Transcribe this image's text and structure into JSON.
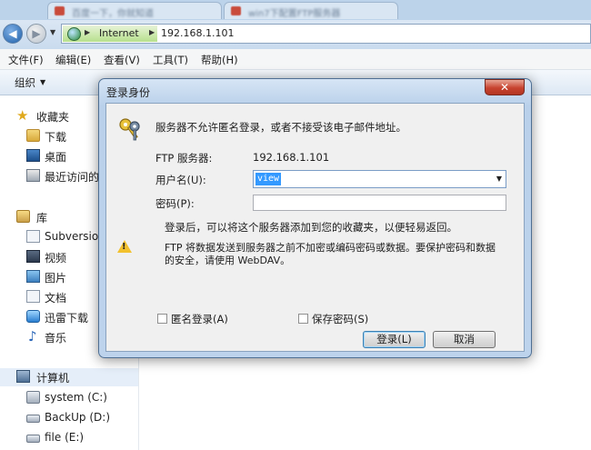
{
  "browser": {
    "tabs": [
      {
        "title": "百度一下，你就知道"
      },
      {
        "title": "win7下配置FTP服务器"
      }
    ]
  },
  "address_bar": {
    "crumb": "Internet",
    "host": "192.168.1.101"
  },
  "menu": {
    "items": [
      "文件(F)",
      "编辑(E)",
      "查看(V)",
      "工具(T)",
      "帮助(H)"
    ]
  },
  "toolbar": {
    "organize_label": "组织"
  },
  "sidebar": {
    "favorites": {
      "label": "收藏夹",
      "items": [
        "下载",
        "桌面",
        "最近访问的"
      ]
    },
    "libraries": {
      "label": "库",
      "items": [
        "Subversion",
        "视频",
        "图片",
        "文档",
        "迅雷下载",
        "音乐"
      ]
    },
    "computer": {
      "label": "计算机",
      "drives": [
        "system (C:)",
        "BackUp (D:)",
        "file (E:)"
      ]
    }
  },
  "dialog": {
    "title": "登录身份",
    "close_label": "✕",
    "intro": "服务器不允许匿名登录，或者不接受该电子邮件地址。",
    "server_label": "FTP 服务器:",
    "server_value": "192.168.1.101",
    "username_label": "用户名(U):",
    "username_value": "view",
    "password_label": "密码(P):",
    "password_value": "",
    "favorites_note": "登录后，可以将这个服务器添加到您的收藏夹，以便轻易返回。",
    "warning_line1": "FTP 将数据发送到服务器之前不加密或编码密码或数据。要保护密码和数据",
    "warning_line2": "的安全，请使用 WebDAV。",
    "anonymous_label": "匿名登录(A)",
    "anonymous_checked": false,
    "save_password_label": "保存密码(S)",
    "save_password_checked": false,
    "login_button": "登录(L)",
    "cancel_button": "取消"
  }
}
